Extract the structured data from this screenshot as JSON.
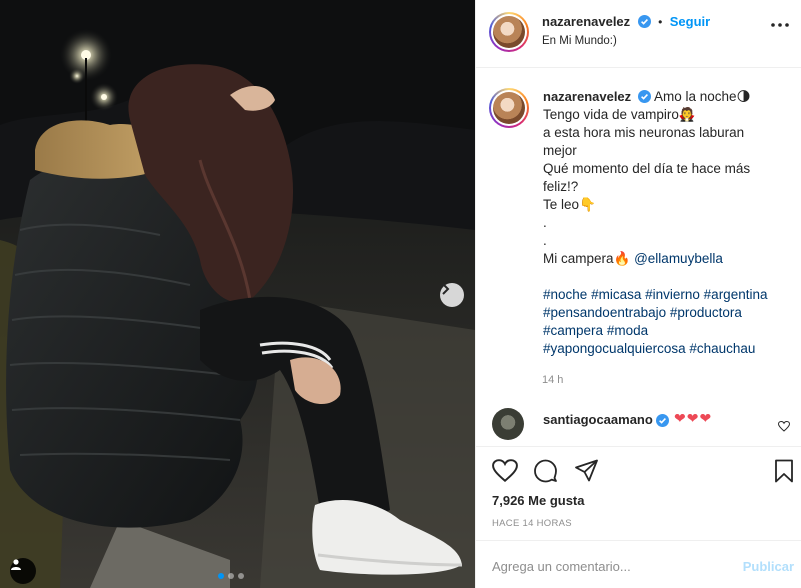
{
  "post": {
    "username": "nazarenavelez",
    "follow_label": "Seguir",
    "separator": "•",
    "location": "En Mi Mundo:)",
    "more_icon": "more-horizontal-icon"
  },
  "caption": {
    "username": "nazarenavelez",
    "line1": "Amo la noche🌗",
    "line2": "Tengo vida de vampiro🧛",
    "line3": "a esta hora mis neuronas laburan",
    "line4": "mejor",
    "line5": "Qué momento del día te hace más",
    "line6": "feliz!?",
    "line7": "Te leo👇",
    "line8": ".",
    "line9": ".",
    "line10_prefix": "Mi campera🔥 ",
    "line10_mention": "@ellamuybella",
    "hashtags": [
      "#noche",
      "#micasa",
      "#invierno",
      "#argentina",
      "#pensandoentrabajo",
      "#productora",
      "#campera",
      "#moda",
      "#yapongocualquiercosa",
      "#chauchau"
    ],
    "time": "14 h"
  },
  "comment": {
    "username": "santiagocaamano",
    "text": "❤❤❤"
  },
  "actions": {
    "likes": "7,926 Me gusta",
    "posted": "HACE 14 HORAS",
    "icons": [
      "heart-icon",
      "comment-icon",
      "share-icon",
      "bookmark-icon"
    ]
  },
  "comment_bar": {
    "placeholder": "Agrega un comentario...",
    "publish_label": "Publicar"
  },
  "colors": {
    "accent": "#0095f6",
    "link": "#00376b",
    "muted": "#8e8e8e",
    "heart": "#ed4956"
  },
  "carousel": {
    "slides": 3,
    "active": 1
  }
}
